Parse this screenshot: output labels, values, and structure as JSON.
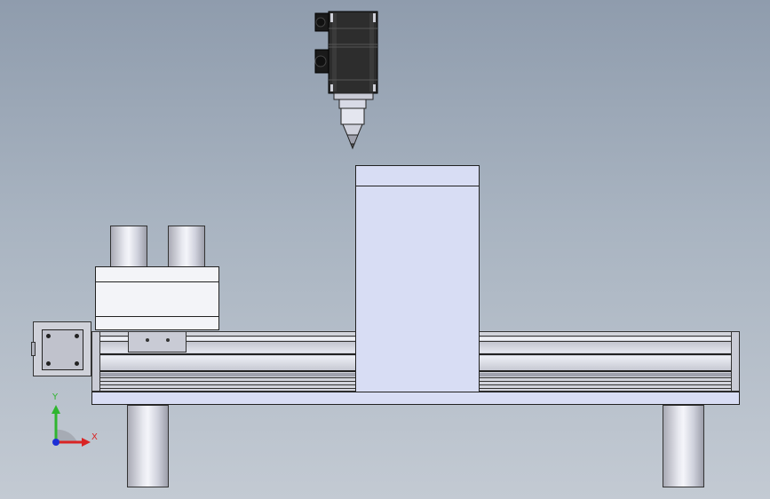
{
  "viewport": {
    "background_top": "#8f9cad",
    "background_bottom": "#c3cad3"
  },
  "triad": {
    "y_label": "Y",
    "x_label": "X",
    "y_color": "#2fb52f",
    "x_color": "#d92424",
    "z_color": "#1c2fd6"
  },
  "colors": {
    "block_fill": "#d8ddf4",
    "motor_body": "#2b2b2b",
    "rail": "#d0d2da"
  }
}
